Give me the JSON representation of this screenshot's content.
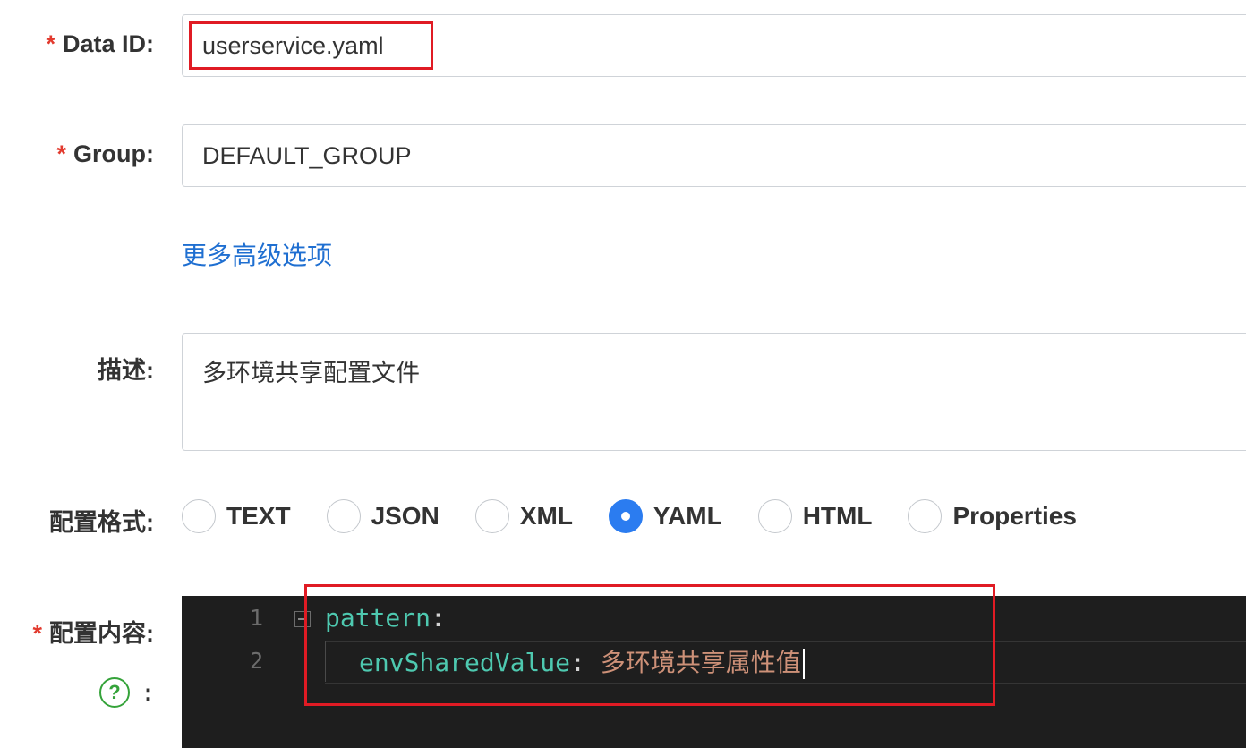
{
  "form": {
    "data_id": {
      "label": "Data ID:",
      "value": "userservice.yaml"
    },
    "group": {
      "label": "Group:",
      "value": "DEFAULT_GROUP"
    },
    "advanced_link": "更多高级选项",
    "description": {
      "label": "描述:",
      "value": "多环境共享配置文件"
    },
    "format": {
      "label": "配置格式:",
      "options": [
        "TEXT",
        "JSON",
        "XML",
        "YAML",
        "HTML",
        "Properties"
      ],
      "selected": "YAML"
    },
    "content": {
      "label": "配置内容:",
      "help_suffix": ":"
    },
    "required_mark": "*"
  },
  "editor": {
    "lines": [
      {
        "number": "1",
        "key": "pattern",
        "sep": ":",
        "value": ""
      },
      {
        "number": "2",
        "key": "envSharedValue",
        "sep": ": ",
        "value": "多环境共享属性值"
      }
    ]
  },
  "colors": {
    "accent": "#2b7cf0",
    "highlight_box": "#e01b24",
    "required": "#e23a2e",
    "editor_bg": "#1e1e1e"
  },
  "icons": {
    "fold": "fold-minus-icon",
    "help": "question-circle-icon"
  }
}
